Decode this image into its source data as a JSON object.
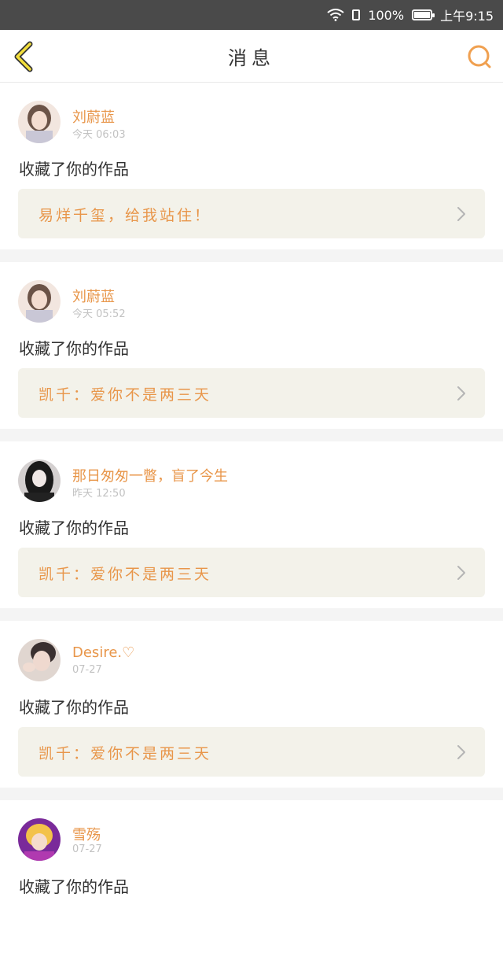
{
  "status_bar": {
    "battery": "100%",
    "time": "上午9:15"
  },
  "header": {
    "title": "消息",
    "back_icon": "chevron-left-icon",
    "search_icon": "search-icon"
  },
  "colors": {
    "accent": "#e8964a",
    "work_box_bg": "#f3f2ea",
    "back_icon_fill": "#f2de3c"
  },
  "messages": [
    {
      "user": "刘蔚蓝",
      "time": "今天 06:03",
      "action": "收藏了你的作品",
      "work_title": "易烊千玺，给我站住！",
      "avatar_colors": [
        "#f2e6df",
        "#6b5347"
      ]
    },
    {
      "user": "刘蔚蓝",
      "time": "今天 05:52",
      "action": "收藏了你的作品",
      "work_title": "凯千：爱你不是两三天",
      "avatar_colors": [
        "#f2e6df",
        "#6b5347"
      ]
    },
    {
      "user": "那日匆匆一瞥，盲了今生",
      "time": "昨天 12:50",
      "action": "收藏了你的作品",
      "work_title": "凯千：爱你不是两三天",
      "avatar_colors": [
        "#d4d0d0",
        "#1a1a1a"
      ]
    },
    {
      "user": "Desire.♡",
      "time": "07-27",
      "action": "收藏了你的作品",
      "work_title": "凯千：爱你不是两三天",
      "avatar_colors": [
        "#e0d6d0",
        "#3a3030"
      ]
    },
    {
      "user": "雪殇",
      "time": "07-27",
      "action": "收藏了你的作品",
      "work_title": "",
      "avatar_colors": [
        "#7a2a9a",
        "#f3c24a"
      ]
    }
  ]
}
